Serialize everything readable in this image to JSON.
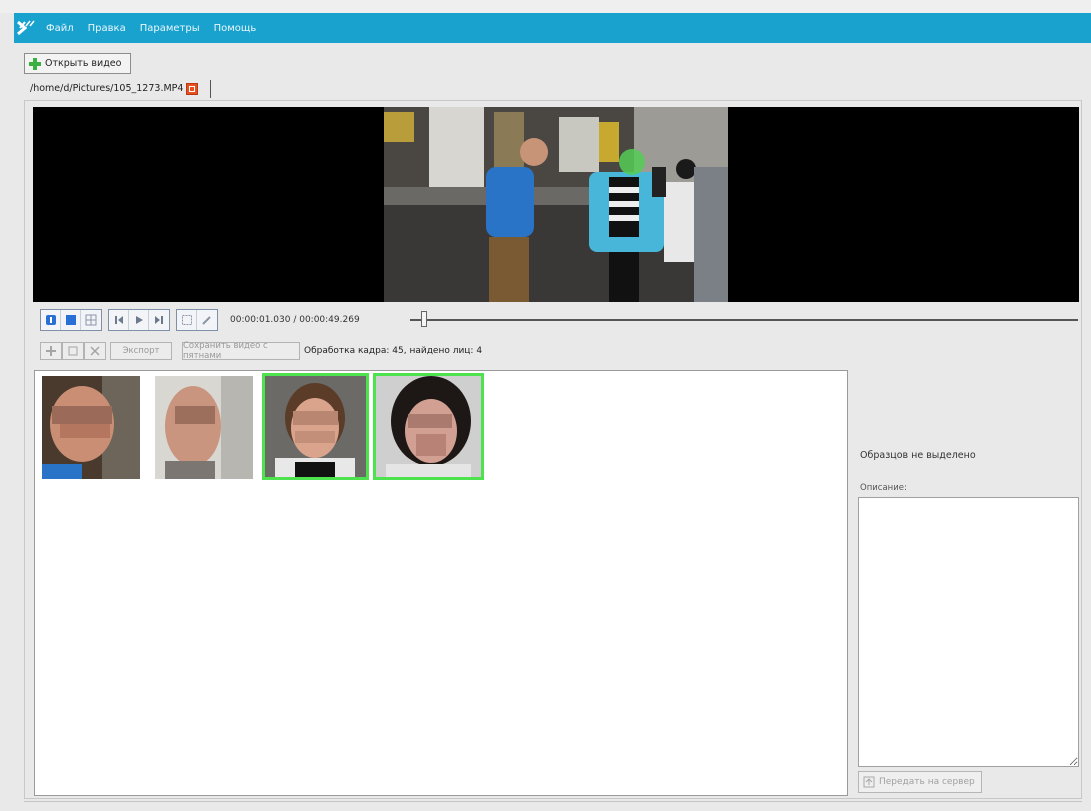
{
  "menu": {
    "items": [
      "Файл",
      "Правка",
      "Параметры",
      "Помощь"
    ]
  },
  "toolbar": {
    "open_video_label": "Открыть видео"
  },
  "tab": {
    "path": "/home/d/Pictures/105_1273.MP4"
  },
  "player": {
    "timecode": "00:00:01.030 / 00:00:49.269",
    "position_fraction": 0.021
  },
  "actions": {
    "export_label": "Экспорт",
    "save_video_label": "Сохранить видео с пятнами",
    "status": "Обработка кадра: 45, найдено лиц: 4"
  },
  "gallery": {
    "faces": [
      {
        "name": "face-1",
        "selected": false
      },
      {
        "name": "face-2",
        "selected": false
      },
      {
        "name": "face-3",
        "selected": true
      },
      {
        "name": "face-4",
        "selected": true
      }
    ]
  },
  "side": {
    "no_selection": "Образцов не выделено",
    "description_label": "Описание:",
    "send_button_label": "Передать на сервер"
  },
  "colors": {
    "menubar": "#1aa2cf",
    "selection": "#4ee24e",
    "accent": "#2a6fd6"
  }
}
